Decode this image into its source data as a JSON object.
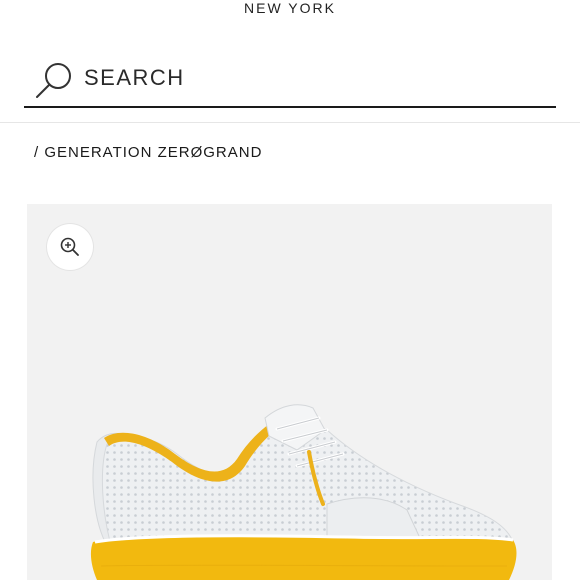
{
  "header": {
    "brand_subtitle": "NEW YORK"
  },
  "search": {
    "label": "SEARCH",
    "icon": "search-icon"
  },
  "breadcrumb": {
    "text": "/ GENERATION ZERØGRAND"
  },
  "product": {
    "zoom_icon": "zoom-in-icon",
    "colors": {
      "sole": "#F2B90F",
      "upper": "#ECEEF0",
      "collar": "#EDB21A"
    }
  }
}
